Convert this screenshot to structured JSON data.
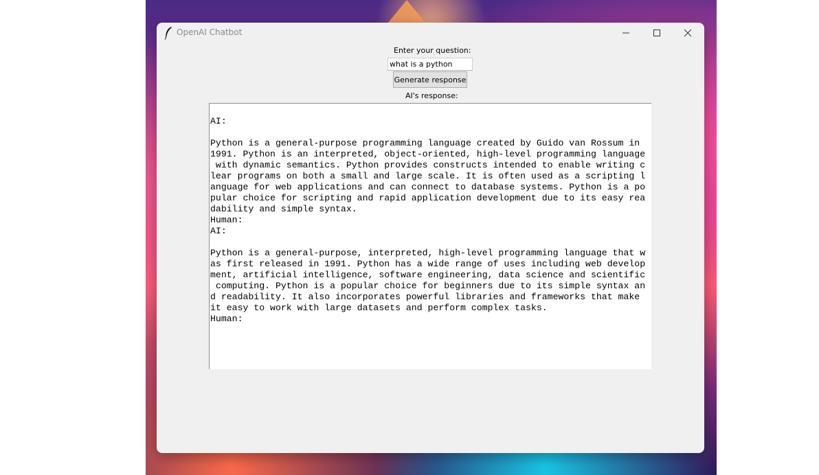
{
  "window": {
    "title": "OpenAI Chatbot",
    "controls": {
      "minimize": "minimize-icon",
      "maximize": "maximize-icon",
      "close": "close-icon"
    }
  },
  "form": {
    "question_label": "Enter your question:",
    "question_value": "what is a python",
    "generate_button_label": "Generate response",
    "response_label": "AI's response:"
  },
  "response": {
    "lines": [
      "AI:",
      "",
      "Python is a general-purpose programming language created by Guido van Rossum in",
      "1991. Python is an interpreted, object-oriented, high-level programming language",
      " with dynamic semantics. Python provides constructs intended to enable writing c",
      "lear programs on both a small and large scale. It is often used as a scripting l",
      "anguage for web applications and can connect to database systems. Python is a po",
      "pular choice for scripting and rapid application development due to its easy rea",
      "dability and simple syntax.",
      "Human:",
      "AI:",
      "",
      "Python is a general-purpose, interpreted, high-level programming language that w",
      "as first released in 1991. Python has a wide range of uses including web develop",
      "ment, artificial intelligence, software engineering, data science and scientific",
      " computing. Python is a popular choice for beginners due to its simple syntax an",
      "d readability. It also incorporates powerful libraries and frameworks that make",
      "it easy to work with large datasets and perform complex tasks.",
      "Human:"
    ]
  }
}
